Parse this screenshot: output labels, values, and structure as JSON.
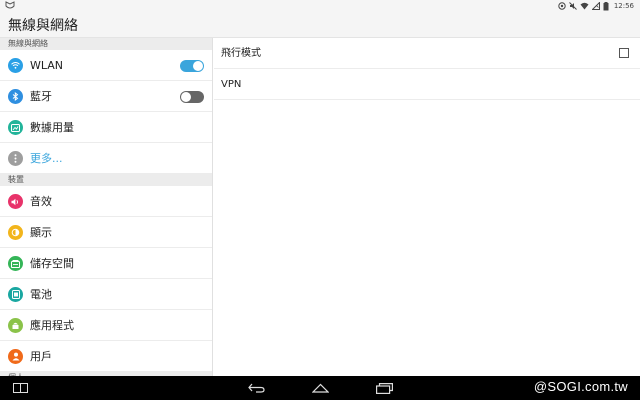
{
  "status_bar": {
    "time": "12:56",
    "left_icon": "notification-shield-icon",
    "right_icons": [
      "location-icon",
      "mute-icon",
      "wifi-icon",
      "no-sim-icon",
      "battery-icon"
    ]
  },
  "header": {
    "title": "無線與網絡"
  },
  "left_panel": {
    "sections": [
      {
        "title": "無線與網絡",
        "items": [
          {
            "label": "WLAN",
            "icon": "wifi-icon",
            "icon_color": "#2aa0e6",
            "toggle": "on"
          },
          {
            "label": "藍牙",
            "icon": "bluetooth-icon",
            "icon_color": "#2f8fe0",
            "toggle": "off"
          },
          {
            "label": "數據用量",
            "icon": "data-usage-icon",
            "icon_color": "#22b49a"
          },
          {
            "label": "更多...",
            "icon": "more-icon",
            "icon_color": "#9e9e9e",
            "link": true
          }
        ]
      },
      {
        "title": "裝置",
        "items": [
          {
            "label": "音效",
            "icon": "sound-icon",
            "icon_color": "#e8336a"
          },
          {
            "label": "顯示",
            "icon": "display-icon",
            "icon_color": "#f2b51c"
          },
          {
            "label": "儲存空間",
            "icon": "storage-icon",
            "icon_color": "#35b558"
          },
          {
            "label": "電池",
            "icon": "battery-icon",
            "icon_color": "#1aa7a1"
          },
          {
            "label": "應用程式",
            "icon": "apps-icon",
            "icon_color": "#8bc34a"
          },
          {
            "label": "用戶",
            "icon": "user-icon",
            "icon_color": "#f06a1a"
          }
        ]
      },
      {
        "title": "個人",
        "items": []
      }
    ]
  },
  "right_panel": {
    "items": [
      {
        "label": "飛行模式",
        "checkbox": false
      },
      {
        "label": "VPN"
      }
    ]
  },
  "nav_bar": {
    "buttons": [
      "recent-apps-icon",
      "back-icon",
      "home-icon",
      "overview-icon"
    ],
    "watermark": "@SOGI.com.tw"
  },
  "colors": {
    "accent": "#3aa5dc",
    "toggle_off": "#666666",
    "nav_bg": "#000000"
  }
}
